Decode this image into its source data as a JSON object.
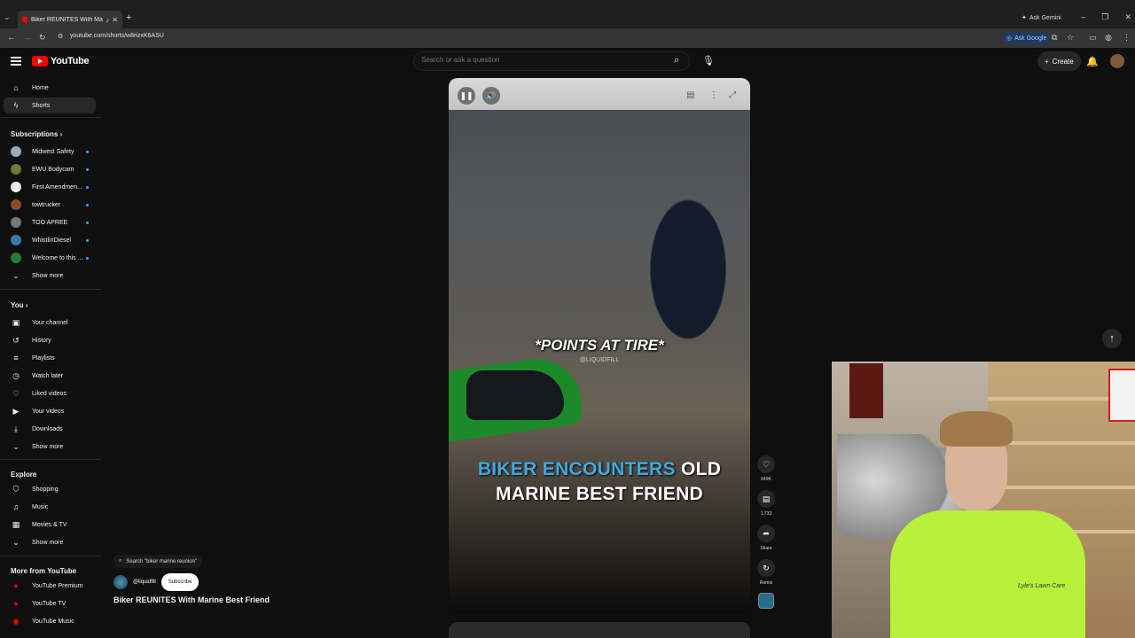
{
  "browser": {
    "tab_title": "Biker REUNITES With Marin",
    "url": "youtube.com/shorts/w8rizxK6ASU",
    "ask_gemini": "Ask Gemini",
    "ask_google": "Ask Google"
  },
  "header": {
    "logo": "YouTube",
    "search_placeholder": "Search or ask a question",
    "create_label": "Create"
  },
  "sidebar": {
    "main": [
      {
        "label": "Home",
        "icon": "home-icon"
      },
      {
        "label": "Shorts",
        "icon": "shorts-icon",
        "active": true
      }
    ],
    "subscriptions_heading": "Subscriptions",
    "subscriptions": [
      {
        "label": "Midwest Safety",
        "color": "#9ab"
      },
      {
        "label": "EWU Bodycam",
        "color": "#6a7a3a"
      },
      {
        "label": "First Amendmen...",
        "color": "#eeeeee"
      },
      {
        "label": "towtrucker",
        "color": "#8a4a2a"
      },
      {
        "label": "TOO APREE",
        "color": "#777777"
      },
      {
        "label": "WhistlinDiesel",
        "color": "#3a7aa8"
      },
      {
        "label": "Welcome to this ...",
        "color": "#2a7a3a"
      }
    ],
    "show_more": "Show more",
    "you_heading": "You",
    "you": [
      {
        "label": "Your channel",
        "icon": "channel-icon"
      },
      {
        "label": "History",
        "icon": "history-icon"
      },
      {
        "label": "Playlists",
        "icon": "playlists-icon"
      },
      {
        "label": "Watch later",
        "icon": "watch-later-icon"
      },
      {
        "label": "Liked videos",
        "icon": "like-icon"
      },
      {
        "label": "Your videos",
        "icon": "your-videos-icon"
      },
      {
        "label": "Downloads",
        "icon": "download-icon"
      }
    ],
    "explore_heading": "Explore",
    "explore": [
      {
        "label": "Shopping",
        "icon": "shopping-icon"
      },
      {
        "label": "Music",
        "icon": "music-icon"
      },
      {
        "label": "Movies & TV",
        "icon": "movies-icon"
      }
    ],
    "more_heading": "More from YouTube",
    "more": [
      {
        "label": "YouTube Premium",
        "icon": "youtube-premium-icon"
      },
      {
        "label": "YouTube TV",
        "icon": "youtube-tv-icon"
      },
      {
        "label": "YouTube Music",
        "icon": "youtube-music-icon"
      }
    ]
  },
  "player": {
    "caption": "*POINTS AT TIRE*",
    "watermark": "@LIQUIDFILL",
    "overlay_line1_a": "BIKER ENCOUNTERS",
    "overlay_line1_b": "OLD",
    "overlay_line2": "MARINE BEST FRIEND"
  },
  "actions": {
    "likes": "649K",
    "comments": "1,732",
    "share": "Share",
    "remix": "Remix"
  },
  "meta": {
    "search_chip": "Search \"biker marine reunion\"",
    "channel": "@liquidfill",
    "subscribe": "Subscribe",
    "title": "Biker REUNITES With Marine Best Friend"
  },
  "webcam": {
    "shirt_text": "Lyle's Lawn Care"
  }
}
